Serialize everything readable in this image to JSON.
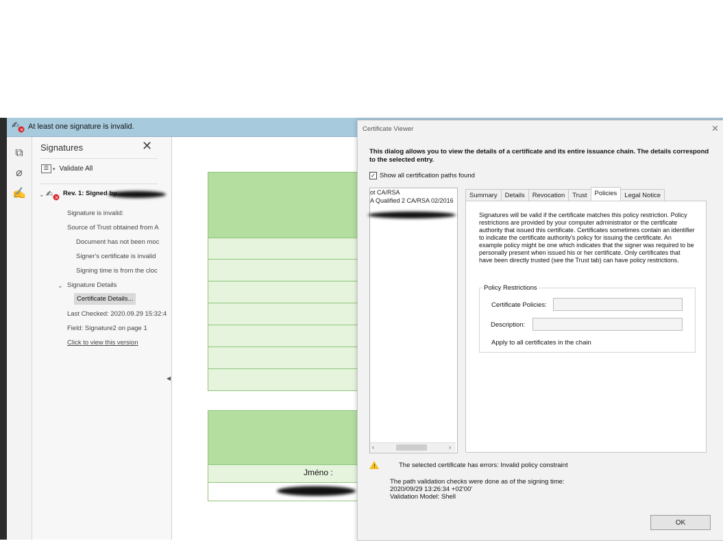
{
  "banner": {
    "text": "At least one signature is invalid."
  },
  "signatures_panel": {
    "title": "Signatures",
    "validate_all": "Validate All",
    "rev_label": "Rev. 1: Signed by",
    "items": [
      "Signature is invalid:",
      "Source of Trust obtained from A",
      "Document has not been moc",
      "Signer's certificate is invalid",
      "Signing time is from the cloc",
      "Signature Details",
      "Certificate Details...",
      "Last Checked: 2020.09.29 15:32:4",
      "Field: Signature2 on page 1",
      "Click to view this version"
    ]
  },
  "document": {
    "name_label": "Jméno :"
  },
  "dialog": {
    "title": "Certificate Viewer",
    "intro": "This dialog allows you to view the details of a certificate and its entire issuance chain. The details correspond to the selected entry.",
    "show_all_paths": "Show all certification paths found",
    "tree": [
      "ot CA/RSA",
      "A Qualified 2 CA/RSA 02/2016"
    ],
    "tabs": [
      "Summary",
      "Details",
      "Revocation",
      "Trust",
      "Policies",
      "Legal Notice"
    ],
    "active_tab": "Policies",
    "policy_text": "Signatures will be valid if the certificate matches this policy restriction. Policy restrictions are provided by your computer administrator or the certificate authority that issued this certificate. Certificates sometimes contain an identifier to indicate the certificate authority's policy for issuing the certificate. An example policy might be one which indicates that the signer was required to be personally present when issued his or her certificate. Only certificates that have been directly trusted (see the Trust tab) can have policy restrictions.",
    "policy_restrictions": {
      "title": "Policy Restrictions",
      "cert_policies_label": "Certificate Policies:",
      "cert_policies_value": "",
      "description_label": "Description:",
      "description_value": "",
      "apply_all": "Apply to all certificates in the chain"
    },
    "status": "The selected certificate has errors: Invalid policy constraint",
    "path_check": [
      "The path validation checks were done as of the signing time:",
      "2020/09/29 13:26:34 +02'00'",
      "Validation Model: Shell"
    ],
    "ok_label": "OK"
  }
}
